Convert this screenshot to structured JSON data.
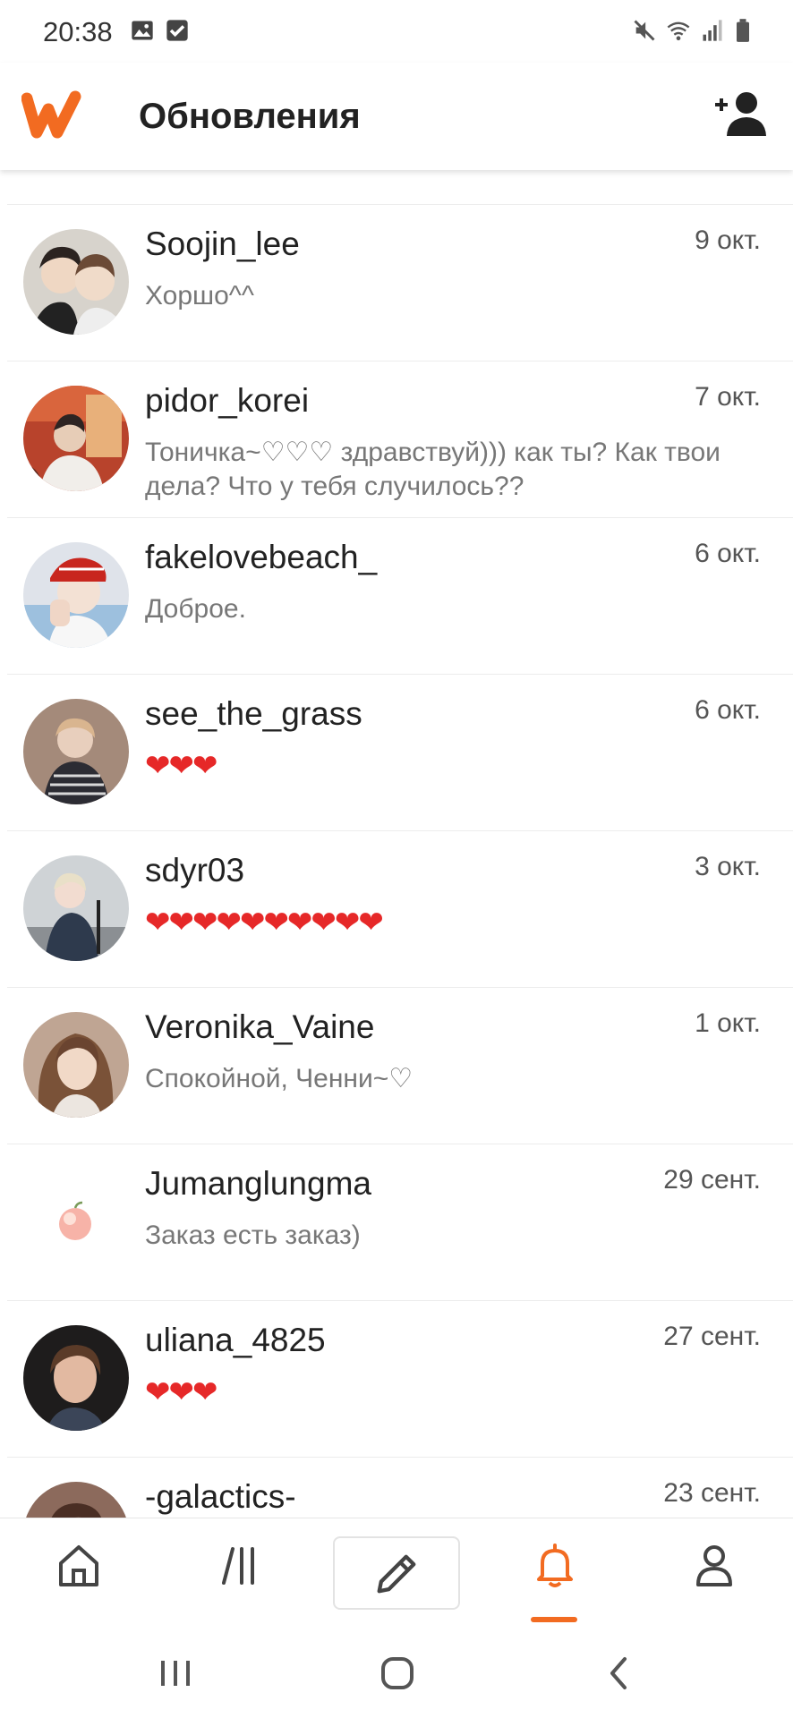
{
  "status": {
    "time": "20:38"
  },
  "header": {
    "title": "Обновления"
  },
  "colors": {
    "accent": "#f26b21",
    "heart": "#e62828"
  },
  "messages": [
    {
      "username": "Soojin_lee",
      "date": "9 окт.",
      "preview": "Хоршо^^",
      "avatar": "duo-photo"
    },
    {
      "username": "pidor_korei",
      "date": "7 окт.",
      "preview": "Тоничка~♡♡♡ здравствуй))) как ты? Как твои дела? Что у тебя случилось??",
      "avatar": "red-photo"
    },
    {
      "username": "fakelovebeach_",
      "date": "6 окт.",
      "preview": "Доброе.",
      "avatar": "red-bandana-photo"
    },
    {
      "username": "see_the_grass",
      "date": "6 окт.",
      "preview": "❤❤❤",
      "avatar": "brown-photo"
    },
    {
      "username": "sdyr03",
      "date": "3 окт.",
      "preview": "❤❤❤❤❤❤❤❤❤❤",
      "avatar": "street-photo"
    },
    {
      "username": "Veronika_Vaine",
      "date": "1 окт.",
      "preview": "Спокойной, Ченни~♡",
      "avatar": "girl-photo"
    },
    {
      "username": "Jumanglungma",
      "date": "29 сент.",
      "preview": "Заказ есть заказ)",
      "avatar": "peach-photo"
    },
    {
      "username": "uliana_4825",
      "date": "27 сент.",
      "preview": "❤❤❤",
      "avatar": "dark-photo"
    },
    {
      "username": "-galactics-",
      "date": "23 сент.",
      "preview": "",
      "avatar": "partial-photo"
    }
  ],
  "bottom_nav": [
    {
      "icon": "home-icon"
    },
    {
      "icon": "library-icon"
    },
    {
      "icon": "pencil-icon"
    },
    {
      "icon": "bell-icon",
      "active": true
    },
    {
      "icon": "profile-icon"
    }
  ]
}
